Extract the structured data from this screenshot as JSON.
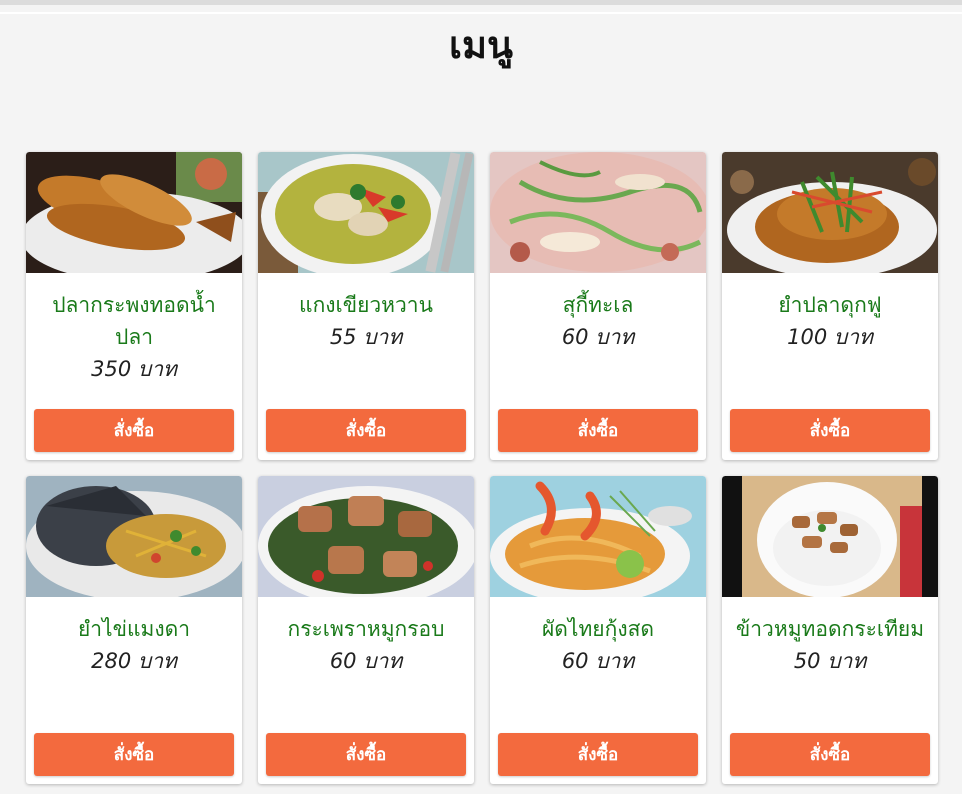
{
  "page": {
    "title": "เมนู"
  },
  "menu": {
    "items": [
      {
        "name": "ปลากระพงทอดน้ำปลา",
        "price": "350 บาท",
        "button": "สั่งซื้อ",
        "image": "fried-fish-photo"
      },
      {
        "name": "แกงเขียวหวาน",
        "price": "55 บาท",
        "button": "สั่งซื้อ",
        "image": "green-curry-photo"
      },
      {
        "name": "สุกี้ทะเล",
        "price": "60 บาท",
        "button": "สั่งซื้อ",
        "image": "seafood-suki-photo"
      },
      {
        "name": "ยำปลาดุกฟู",
        "price": "100 บาท",
        "button": "สั่งซื้อ",
        "image": "crispy-catfish-salad-photo"
      },
      {
        "name": "ยำไข่แมงดา",
        "price": "280 บาท",
        "button": "สั่งซื้อ",
        "image": "horseshoe-crab-egg-salad-photo"
      },
      {
        "name": "กระเพราหมูกรอบ",
        "price": "60 บาท",
        "button": "สั่งซื้อ",
        "image": "crispy-pork-basil-photo"
      },
      {
        "name": "ผัดไทยกุ้งสด",
        "price": "60 บาท",
        "button": "สั่งซื้อ",
        "image": "pad-thai-shrimp-photo"
      },
      {
        "name": "ข้าวหมูทอดกระเทียม",
        "price": "50 บาท",
        "button": "สั่งซื้อ",
        "image": "garlic-pork-rice-photo"
      }
    ]
  },
  "colors": {
    "item_name": "#1a7a1a",
    "button": "#f36a3e",
    "background": "#f4f4f4"
  }
}
